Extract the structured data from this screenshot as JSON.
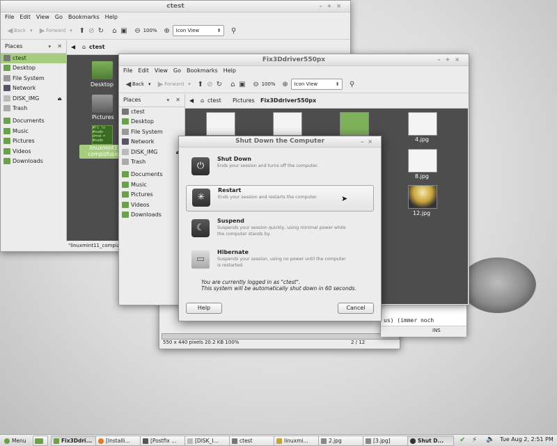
{
  "colors": {
    "accent": "#a6cc7e",
    "content_bg": "#4d4d4d",
    "folder": "#6ca04a"
  },
  "win1": {
    "title": "ctest",
    "menu": [
      "File",
      "Edit",
      "View",
      "Go",
      "Bookmarks",
      "Help"
    ],
    "toolbar": {
      "back": "Back",
      "forward": "Forward",
      "zoom": "100%",
      "view": "Icon View"
    },
    "places_label": "Places",
    "location": "ctest",
    "sidebar": [
      "ctest",
      "Desktop",
      "File System",
      "Network",
      "DISK_IMG",
      "Trash",
      "Documents",
      "Music",
      "Pictures",
      "Videos",
      "Downloads"
    ],
    "items": {
      "desktop": "Desktop",
      "pictures": "Pictures",
      "script_text": "#!l !n\n#sudo\nd=nd =\n#sudo",
      "selected_line1": "linuxmint11",
      "selected_line2": "compizfusion"
    },
    "status": "\"linuxmint11_compiz"
  },
  "win2": {
    "title": "Fix3Ddriver550px",
    "menu": [
      "File",
      "Edit",
      "View",
      "Go",
      "Bookmarks",
      "Help"
    ],
    "toolbar": {
      "back": "Back",
      "forward": "Forward",
      "zoom": "100%",
      "view": "Icon View"
    },
    "places_label": "Places",
    "breadcrumb": [
      "ctest",
      "Pictures",
      "Fix3Ddriver550px"
    ],
    "sidebar": [
      "ctest",
      "Desktop",
      "File System",
      "Network",
      "DISK_IMG",
      "Trash",
      "Documents",
      "Music",
      "Pictures",
      "Videos",
      "Downloads"
    ],
    "files": {
      "f4": "4.jpg",
      "f8": "8.jpg",
      "f12": "12.jpg"
    }
  },
  "bg_window": {
    "status_left": "550 x 440 pixels  20.2 KB  100%",
    "status_right": "2 / 12",
    "text_fragment": "us)  (immer noch",
    "ins": "INS"
  },
  "dialog": {
    "title": "Shut Down the Computer",
    "options": [
      {
        "title": "Shut Down",
        "desc": "Ends your session and turns off the computer."
      },
      {
        "title": "Restart",
        "desc": "Ends your session and restarts the computer."
      },
      {
        "title": "Suspend",
        "desc": "Suspends your session quickly, using minimal power while the computer stands by."
      },
      {
        "title": "Hibernate",
        "desc": "Suspends your session, using no power until the computer is restarted."
      }
    ],
    "message_line1": "You are currently logged in as \"ctest\".",
    "message_line2": "This system will be automatically shut down in 60 seconds.",
    "help": "Help",
    "cancel": "Cancel"
  },
  "taskbar": {
    "menu": "Menu",
    "tasks": [
      "Fix3Ddri...",
      "[Installi...",
      "[Postfix ...",
      "[DISK_I...",
      "ctest",
      "linuxmi...",
      "2.jpg",
      "[3.jpg]",
      "Shut D..."
    ],
    "clock": "Tue Aug  2,  2:51 PM"
  }
}
